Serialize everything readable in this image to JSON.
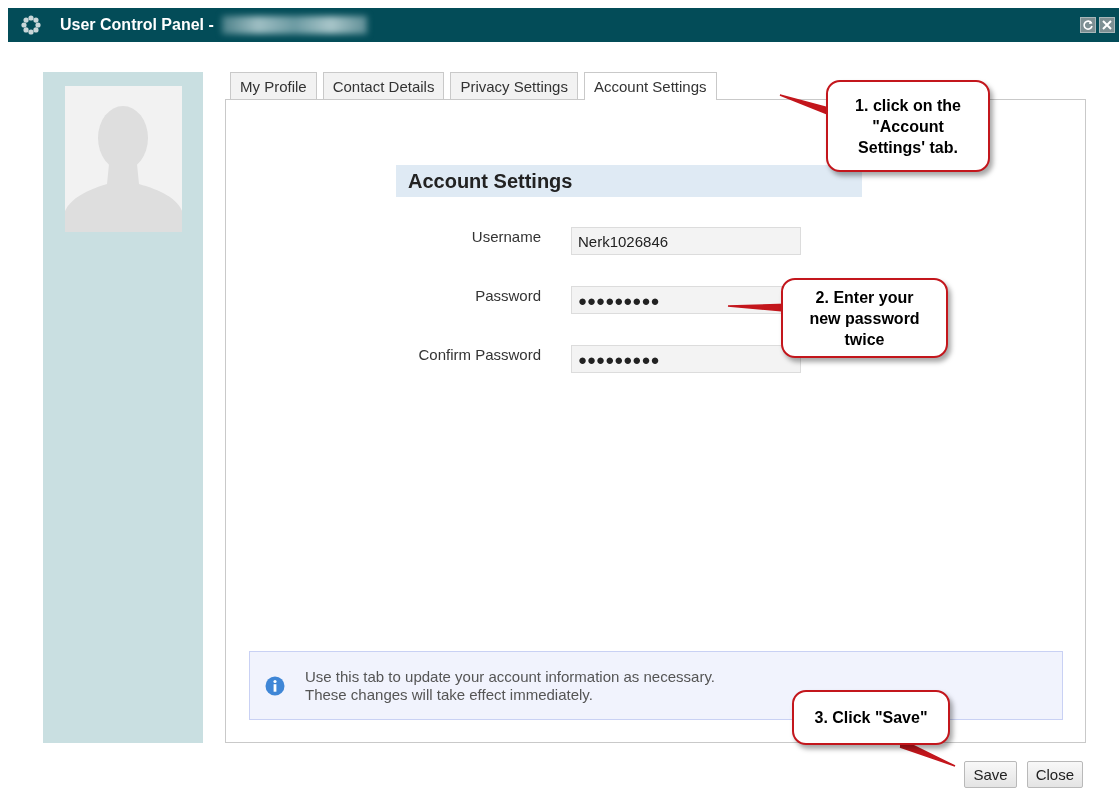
{
  "window": {
    "title": "User Control Panel -"
  },
  "tabs": [
    {
      "label": "My Profile",
      "selected": false
    },
    {
      "label": "Contact Details",
      "selected": false
    },
    {
      "label": "Privacy Settings",
      "selected": false
    },
    {
      "label": "Account Settings",
      "selected": true
    }
  ],
  "section": {
    "heading": "Account Settings"
  },
  "fields": [
    {
      "label": "Username",
      "value": "Nerk1026846"
    },
    {
      "label": "Password",
      "value": "●●●●●●●●●"
    },
    {
      "label": "Confirm Password",
      "value": "●●●●●●●●●"
    }
  ],
  "info": {
    "lines": [
      "Use this tab to update your account information as necessary.",
      "These changes will take effect immediately."
    ]
  },
  "buttons": [
    "Save",
    "Close"
  ],
  "callouts": [
    "1. click on the \"Account Settings' tab.",
    "2. Enter your new password twice",
    "3. Click \"Save\""
  ]
}
